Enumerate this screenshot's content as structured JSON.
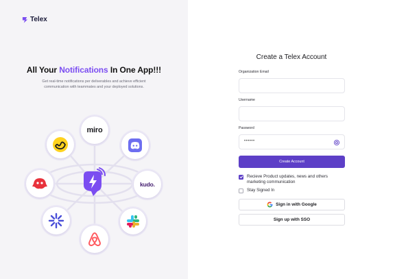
{
  "brand": {
    "name": "Telex",
    "accent": "#7b4df1",
    "primary": "#5d3fc7"
  },
  "hero": {
    "headline_prefix": "All Your ",
    "headline_accent": "Notifications",
    "headline_suffix": " In One App!!!",
    "subtext": "Get real-time notifications per deliverables and achieve efficient communication with teammates and your deployed solutions."
  },
  "integrations": {
    "hub_icon": "bell-lightning-icon",
    "items": [
      {
        "name": "miro",
        "label": "miro"
      },
      {
        "name": "discord",
        "icon": "discord-icon"
      },
      {
        "name": "kudo",
        "label": "kudo."
      },
      {
        "name": "slack",
        "icon": "slack-icon"
      },
      {
        "name": "airbnb",
        "icon": "airbnb-icon"
      },
      {
        "name": "zapier",
        "icon": "zapier-icon"
      },
      {
        "name": "red-bird",
        "icon": "red-bird-icon"
      },
      {
        "name": "basecamp",
        "icon": "basecamp-icon"
      }
    ]
  },
  "form": {
    "title": "Create a Telex Account",
    "org_email_label": "Organization Email",
    "org_email_value": "",
    "username_label": "Username",
    "username_value": "",
    "password_label": "Password",
    "password_value": "••••••",
    "create_button": "Create Account",
    "updates_checkbox_label": "Recieve Product updates, news and others marketing communication",
    "updates_checked": true,
    "stay_signed_label": "Stay Signed In",
    "stay_signed_checked": false,
    "google_button": "Sign in with Google",
    "sso_button": "Sign up with SSO"
  }
}
